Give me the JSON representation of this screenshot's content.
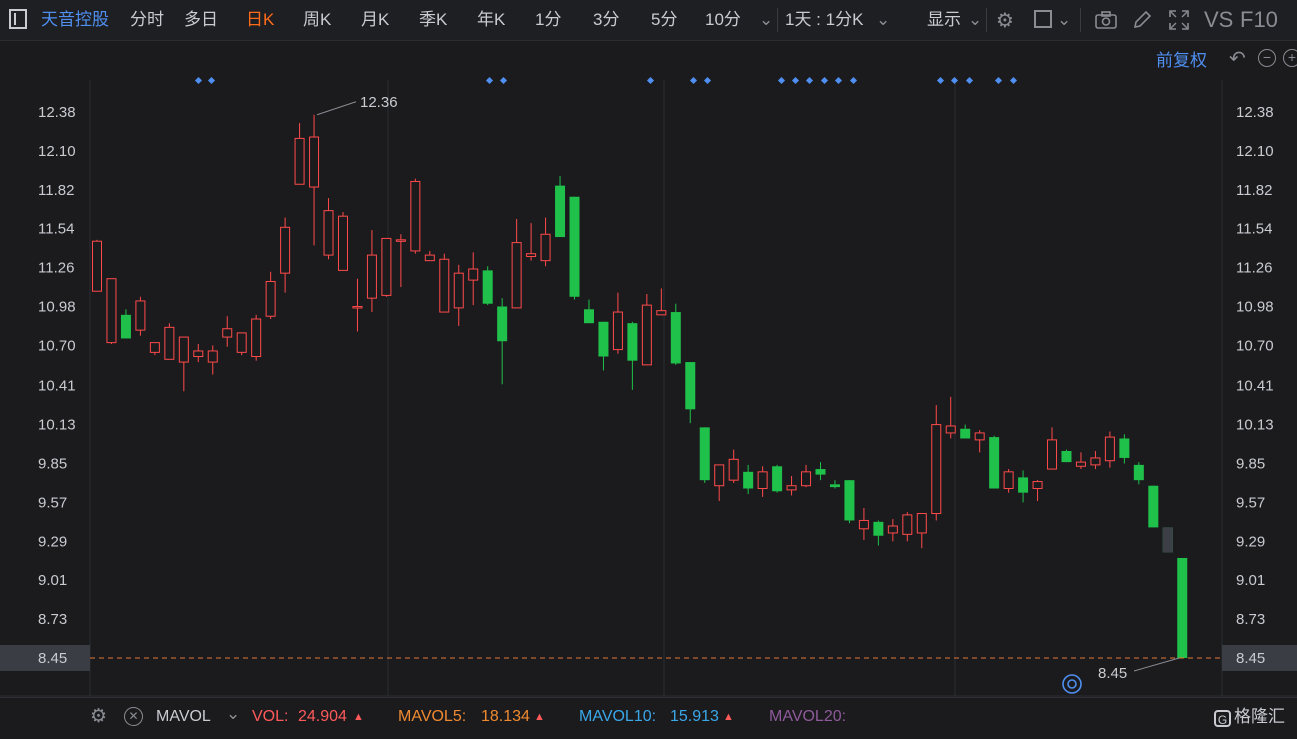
{
  "toolbar": {
    "stock_name": "天音控股",
    "tabs": [
      "分时",
      "多日",
      "日K",
      "周K",
      "月K",
      "季K",
      "年K",
      "1分",
      "3分",
      "5分",
      "10分"
    ],
    "active_tab": "日K",
    "period_select": "1天 : 1分K",
    "display_label": "显示",
    "vs_label": "VS",
    "f10_label": "F10"
  },
  "chart_header": {
    "adjust_label": "前复权"
  },
  "chart_data": {
    "type": "candlestick",
    "y_ticks": [
      12.38,
      12.1,
      11.82,
      11.54,
      11.26,
      10.98,
      10.7,
      10.41,
      10.13,
      9.85,
      9.57,
      9.29,
      9.01,
      8.73,
      8.45
    ],
    "y_tick_labels": [
      "12.38",
      "12.10",
      "11.82",
      "11.54",
      "11.26",
      "10.98",
      "10.70",
      "10.41",
      "10.13",
      "9.85",
      "9.57",
      "9.29",
      "9.01",
      "8.73",
      "8.45"
    ],
    "ylim": [
      8.32,
      12.53
    ],
    "current_price_label": "8.45",
    "high_label": "12.36",
    "low_label": "8.45",
    "colors": {
      "up": "#ff4a4a",
      "down": "#1fc14a",
      "last": "#3c3f46",
      "grid": "#2b2c31",
      "current_line": "#e0783a"
    },
    "candles": [
      {
        "o": 11.09,
        "c": 11.45,
        "h": 11.46,
        "l": 11.09
      },
      {
        "o": 10.72,
        "c": 11.18,
        "h": 11.18,
        "l": 10.71
      },
      {
        "o": 10.92,
        "c": 10.75,
        "h": 10.96,
        "l": 10.75
      },
      {
        "o": 10.81,
        "c": 11.02,
        "h": 11.05,
        "l": 10.77
      },
      {
        "o": 10.65,
        "c": 10.72,
        "h": 10.72,
        "l": 10.63
      },
      {
        "o": 10.6,
        "c": 10.83,
        "h": 10.86,
        "l": 10.6
      },
      {
        "o": 10.58,
        "c": 10.76,
        "h": 10.76,
        "l": 10.37
      },
      {
        "o": 10.62,
        "c": 10.66,
        "h": 10.71,
        "l": 10.58
      },
      {
        "o": 10.58,
        "c": 10.66,
        "h": 10.7,
        "l": 10.49
      },
      {
        "o": 10.76,
        "c": 10.82,
        "h": 10.91,
        "l": 10.69
      },
      {
        "o": 10.65,
        "c": 10.79,
        "h": 10.79,
        "l": 10.63
      },
      {
        "o": 10.62,
        "c": 10.89,
        "h": 10.92,
        "l": 10.59
      },
      {
        "o": 10.91,
        "c": 11.16,
        "h": 11.23,
        "l": 10.89
      },
      {
        "o": 11.22,
        "c": 11.55,
        "h": 11.62,
        "l": 11.08
      },
      {
        "o": 11.86,
        "c": 12.19,
        "h": 12.3,
        "l": 11.86
      },
      {
        "o": 11.84,
        "c": 12.2,
        "h": 12.36,
        "l": 11.42
      },
      {
        "o": 11.35,
        "c": 11.67,
        "h": 11.76,
        "l": 11.32
      },
      {
        "o": 11.24,
        "c": 11.63,
        "h": 11.66,
        "l": 11.24
      },
      {
        "o": 10.98,
        "c": 10.98,
        "h": 11.18,
        "l": 10.8
      },
      {
        "o": 11.04,
        "c": 11.35,
        "h": 11.53,
        "l": 10.94
      },
      {
        "o": 11.06,
        "c": 11.47,
        "h": 11.47,
        "l": 11.05
      },
      {
        "o": 11.46,
        "c": 11.46,
        "h": 11.5,
        "l": 11.12
      },
      {
        "o": 11.38,
        "c": 11.88,
        "h": 11.9,
        "l": 11.36
      },
      {
        "o": 11.31,
        "c": 11.35,
        "h": 11.38,
        "l": 11.31
      },
      {
        "o": 10.94,
        "c": 11.32,
        "h": 11.36,
        "l": 10.94
      },
      {
        "o": 10.97,
        "c": 11.22,
        "h": 11.28,
        "l": 10.84
      },
      {
        "o": 11.17,
        "c": 11.25,
        "h": 11.37,
        "l": 10.99
      },
      {
        "o": 11.24,
        "c": 11.0,
        "h": 11.27,
        "l": 10.99
      },
      {
        "o": 10.98,
        "c": 10.73,
        "h": 11.04,
        "l": 10.42
      },
      {
        "o": 10.97,
        "c": 11.44,
        "h": 11.61,
        "l": 10.97
      },
      {
        "o": 11.34,
        "c": 11.36,
        "h": 11.58,
        "l": 11.31
      },
      {
        "o": 11.31,
        "c": 11.5,
        "h": 11.62,
        "l": 11.27
      },
      {
        "o": 11.85,
        "c": 11.48,
        "h": 11.92,
        "l": 11.48
      },
      {
        "o": 11.77,
        "c": 11.05,
        "h": 11.77,
        "l": 11.03
      },
      {
        "o": 10.96,
        "c": 10.86,
        "h": 11.03,
        "l": 10.86
      },
      {
        "o": 10.87,
        "c": 10.62,
        "h": 10.87,
        "l": 10.52
      },
      {
        "o": 10.67,
        "c": 10.94,
        "h": 11.08,
        "l": 10.64
      },
      {
        "o": 10.86,
        "c": 10.59,
        "h": 10.87,
        "l": 10.38
      },
      {
        "o": 10.56,
        "c": 10.99,
        "h": 11.07,
        "l": 10.56
      },
      {
        "o": 10.92,
        "c": 10.95,
        "h": 11.11,
        "l": 10.92
      },
      {
        "o": 10.94,
        "c": 10.57,
        "h": 11.0,
        "l": 10.56
      },
      {
        "o": 10.58,
        "c": 10.24,
        "h": 10.58,
        "l": 10.14
      },
      {
        "o": 10.11,
        "c": 9.73,
        "h": 10.11,
        "l": 9.71
      },
      {
        "o": 9.69,
        "c": 9.84,
        "h": 9.84,
        "l": 9.58
      },
      {
        "o": 9.73,
        "c": 9.88,
        "h": 9.95,
        "l": 9.71
      },
      {
        "o": 9.79,
        "c": 9.67,
        "h": 9.84,
        "l": 9.63
      },
      {
        "o": 9.67,
        "c": 9.79,
        "h": 9.83,
        "l": 9.61
      },
      {
        "o": 9.83,
        "c": 9.65,
        "h": 9.84,
        "l": 9.64
      },
      {
        "o": 9.66,
        "c": 9.69,
        "h": 9.76,
        "l": 9.62
      },
      {
        "o": 9.69,
        "c": 9.79,
        "h": 9.84,
        "l": 9.68
      },
      {
        "o": 9.81,
        "c": 9.77,
        "h": 9.86,
        "l": 9.73
      },
      {
        "o": 9.7,
        "c": 9.68,
        "h": 9.73,
        "l": 9.67
      },
      {
        "o": 9.73,
        "c": 9.44,
        "h": 9.73,
        "l": 9.42
      },
      {
        "o": 9.38,
        "c": 9.44,
        "h": 9.53,
        "l": 9.3
      },
      {
        "o": 9.43,
        "c": 9.33,
        "h": 9.44,
        "l": 9.26
      },
      {
        "o": 9.35,
        "c": 9.4,
        "h": 9.45,
        "l": 9.29
      },
      {
        "o": 9.34,
        "c": 9.48,
        "h": 9.5,
        "l": 9.29
      },
      {
        "o": 9.35,
        "c": 9.49,
        "h": 9.49,
        "l": 9.24
      },
      {
        "o": 9.49,
        "c": 10.13,
        "h": 10.27,
        "l": 9.44
      },
      {
        "o": 10.07,
        "c": 10.12,
        "h": 10.33,
        "l": 10.03
      },
      {
        "o": 10.1,
        "c": 10.03,
        "h": 10.13,
        "l": 10.03
      },
      {
        "o": 10.02,
        "c": 10.07,
        "h": 10.09,
        "l": 9.93
      },
      {
        "o": 10.04,
        "c": 9.67,
        "h": 10.05,
        "l": 9.67
      },
      {
        "o": 9.67,
        "c": 9.79,
        "h": 9.81,
        "l": 9.64
      },
      {
        "o": 9.75,
        "c": 9.64,
        "h": 9.8,
        "l": 9.57
      },
      {
        "o": 9.67,
        "c": 9.72,
        "h": 9.73,
        "l": 9.58
      },
      {
        "o": 9.81,
        "c": 10.02,
        "h": 10.11,
        "l": 9.81
      },
      {
        "o": 9.94,
        "c": 9.86,
        "h": 9.95,
        "l": 9.86
      },
      {
        "o": 9.83,
        "c": 9.86,
        "h": 9.93,
        "l": 9.81
      },
      {
        "o": 9.84,
        "c": 9.89,
        "h": 9.94,
        "l": 9.81
      },
      {
        "o": 9.87,
        "c": 10.04,
        "h": 10.08,
        "l": 9.82
      },
      {
        "o": 10.03,
        "c": 9.89,
        "h": 10.06,
        "l": 9.85
      },
      {
        "o": 9.84,
        "c": 9.73,
        "h": 9.86,
        "l": 9.7
      },
      {
        "o": 9.69,
        "c": 9.39,
        "h": 9.69,
        "l": 9.39
      },
      {
        "o": 9.39,
        "c": 9.21,
        "h": 9.39,
        "l": 9.21
      },
      {
        "o": 9.17,
        "c": 8.45,
        "h": 9.17,
        "l": 8.45
      }
    ]
  },
  "indicator_bar": {
    "name": "MAVOL",
    "vol_label": "VOL:",
    "vol_value": "24.904",
    "mavol5_label": "MAVOL5:",
    "mavol5_value": "18.134",
    "mavol10_label": "MAVOL10:",
    "mavol10_value": "15.913",
    "mavol20_label": "MAVOL20:",
    "brand": "格隆汇"
  }
}
